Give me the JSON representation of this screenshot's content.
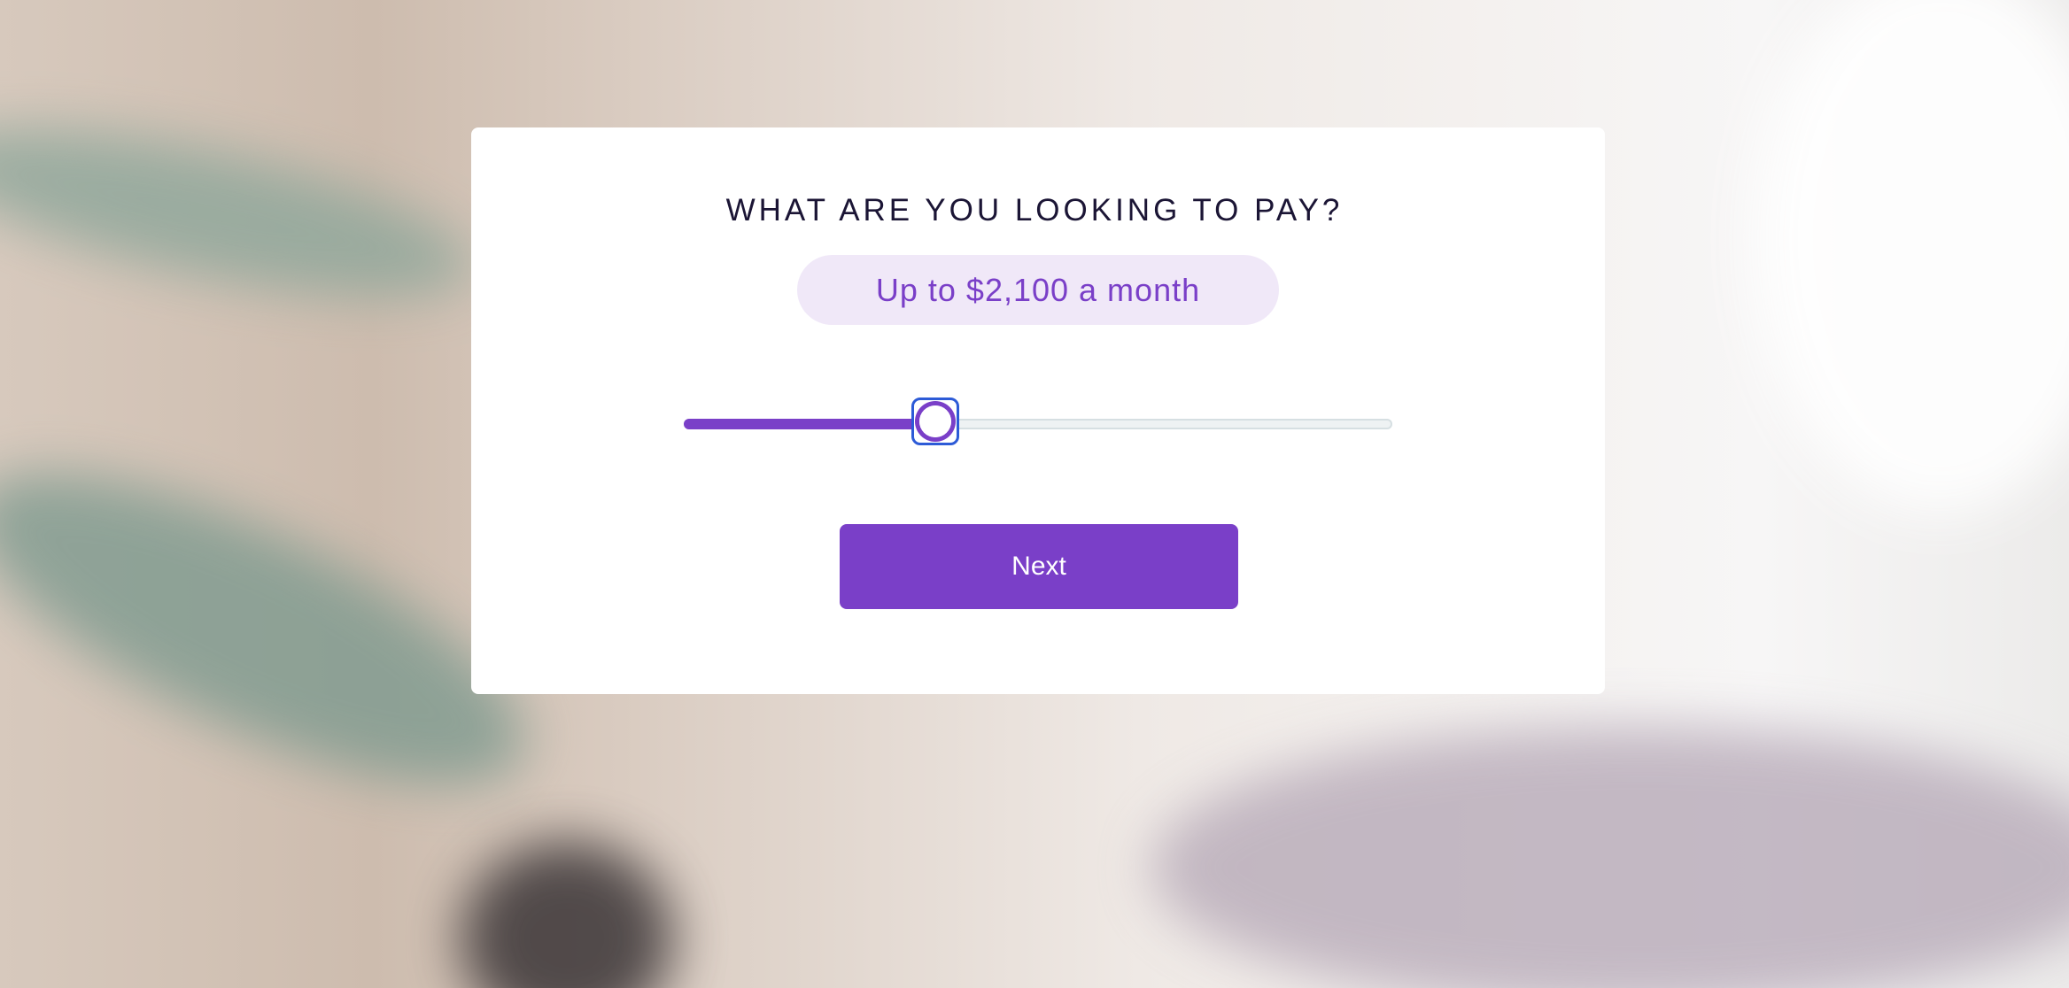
{
  "question": {
    "title": "WHAT ARE YOU LOOKING TO PAY?"
  },
  "budget": {
    "display_label": "Up to $2,100 a month",
    "slider_fraction": 0.355
  },
  "actions": {
    "next_label": "Next"
  },
  "colors": {
    "accent": "#7a3fc8",
    "accent_light": "#f0e8f8",
    "focus_ring": "#2d5bd7",
    "title_text": "#1b1535"
  }
}
